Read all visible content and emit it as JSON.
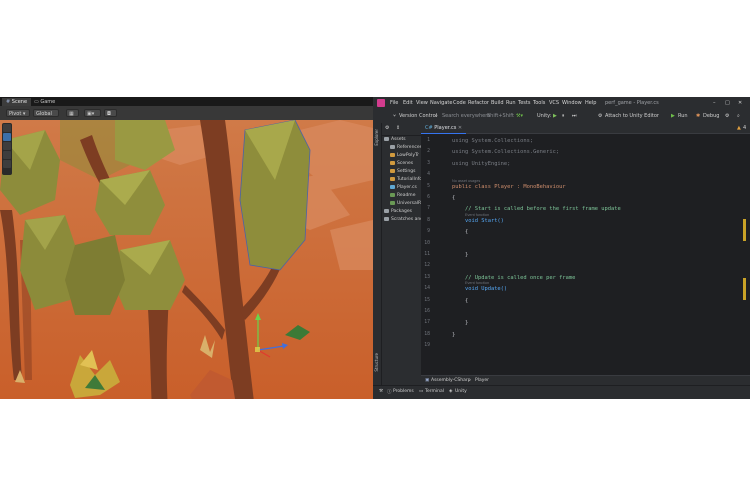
{
  "unity": {
    "tabs": [
      {
        "label": "Scene"
      },
      {
        "label": "Game"
      }
    ],
    "toolbar": {
      "pivot": "Pivot",
      "global": "Global"
    }
  },
  "rider": {
    "menu": [
      "File",
      "Edit",
      "View",
      "Navigate",
      "Code",
      "Refactor",
      "Build",
      "Run",
      "Tests",
      "Tools",
      "VCS",
      "Window",
      "Help"
    ],
    "window_title": "perf_game - Player.cs",
    "toolbar": {
      "version_control": "Version Control",
      "search_placeholder": "Search everywhere",
      "shortcut": "Shift+Shift",
      "unity_label": "Unity:",
      "attach": "Attach to Unity Editor",
      "run": "Run",
      "debug": "Debug"
    },
    "side_stripe": {
      "explorer": "Explorer",
      "structure": "Structure"
    },
    "tree": [
      {
        "label": "Assets",
        "depth": 0,
        "color": "#9aa0a6"
      },
      {
        "label": "References",
        "depth": 1,
        "color": "#9aa0a6"
      },
      {
        "label": "LowPolyTr",
        "depth": 1,
        "color": "#d19a3e"
      },
      {
        "label": "Scenes",
        "depth": 1,
        "color": "#d19a3e"
      },
      {
        "label": "Settings",
        "depth": 1,
        "color": "#d19a3e"
      },
      {
        "label": "TutorialInfo",
        "depth": 1,
        "color": "#d19a3e"
      },
      {
        "label": "Player.cs",
        "depth": 1,
        "color": "#5fa8d3"
      },
      {
        "label": "Readme",
        "depth": 1,
        "color": "#6a9955"
      },
      {
        "label": "UniversalRP",
        "depth": 1,
        "color": "#6a9955"
      },
      {
        "label": "Packages",
        "depth": 0,
        "color": "#9aa0a6"
      },
      {
        "label": "Scratches and",
        "depth": 0,
        "color": "#9aa0a6"
      }
    ],
    "file_tab": "Player.cs",
    "warnings": "4",
    "hints": {
      "no_usages": "No asset usages",
      "event_function": "Event function"
    },
    "code": [
      {
        "n": "1",
        "t": "using System.Collections;"
      },
      {
        "n": "2",
        "t": "using System.Collections.Generic;"
      },
      {
        "n": "3",
        "t": "using UnityEngine;"
      },
      {
        "n": "4",
        "t": ""
      },
      {
        "n": "5",
        "t": "public class Player : MonoBehaviour"
      },
      {
        "n": "6",
        "t": "{"
      },
      {
        "n": "7",
        "t": "    // Start is called before the first frame update"
      },
      {
        "n": "8",
        "t": "    void Start()"
      },
      {
        "n": "9",
        "t": "    {"
      },
      {
        "n": "10",
        "t": ""
      },
      {
        "n": "11",
        "t": "    }"
      },
      {
        "n": "12",
        "t": ""
      },
      {
        "n": "13",
        "t": "    // Update is called once per frame"
      },
      {
        "n": "14",
        "t": "    void Update()"
      },
      {
        "n": "15",
        "t": "    {"
      },
      {
        "n": "16",
        "t": ""
      },
      {
        "n": "17",
        "t": "    }"
      },
      {
        "n": "18",
        "t": "}"
      },
      {
        "n": "19",
        "t": ""
      }
    ],
    "bottom": {
      "breadcrumb_project": "Assembly-CSharp",
      "breadcrumb_class": "Player",
      "tool_tabs": [
        "Problems",
        "Terminal",
        "Unity"
      ]
    }
  }
}
